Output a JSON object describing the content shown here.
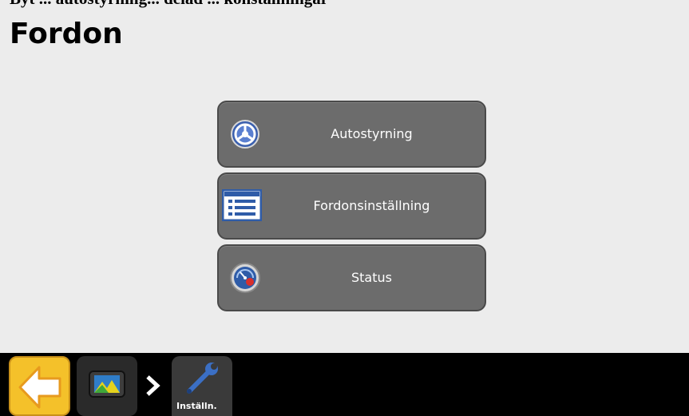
{
  "top_caption": "Byt ... autostyrning... delad ... konstallningar",
  "page_title": "Fordon",
  "menu": {
    "items": [
      {
        "label": "Autostyrning",
        "icon": "steering-wheel-icon"
      },
      {
        "label": "Fordonsinställning",
        "icon": "document-list-icon"
      },
      {
        "label": "Status",
        "icon": "gauge-icon"
      }
    ]
  },
  "bottom_bar": {
    "back_icon": "back-arrow-icon",
    "home_icon": "display-home-icon",
    "breadcrumb_separator_icon": "chevron-right-icon",
    "current": {
      "label": "Inställn.",
      "icon": "wrench-icon"
    }
  },
  "colors": {
    "background": "#ececec",
    "button": "#6c6c6c",
    "button_border": "#4a4a4a",
    "back_button": "#f4c12a",
    "bottom_bar": "#000000"
  }
}
